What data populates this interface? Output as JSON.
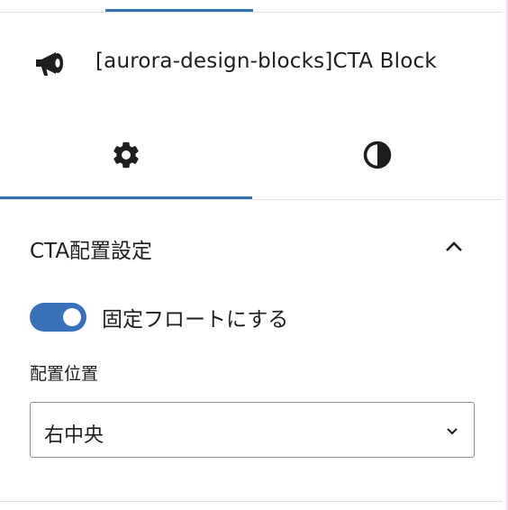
{
  "block": {
    "icon": "megaphone-icon",
    "title": "[aurora-design-blocks]CTA Block"
  },
  "tabs": [
    {
      "id": "settings",
      "icon": "gear-icon",
      "active": true
    },
    {
      "id": "styles",
      "icon": "half-circle-contrast-icon",
      "active": false
    }
  ],
  "panel": {
    "title": "CTA配置設定",
    "expanded": true,
    "toggle": {
      "label": "固定フロートにする",
      "checked": true
    },
    "position_field": {
      "label": "配置位置",
      "value": "右中央"
    }
  },
  "colors": {
    "accent": "#3871b8",
    "divider": "#e0e0e0",
    "text": "#1e1e1e"
  }
}
